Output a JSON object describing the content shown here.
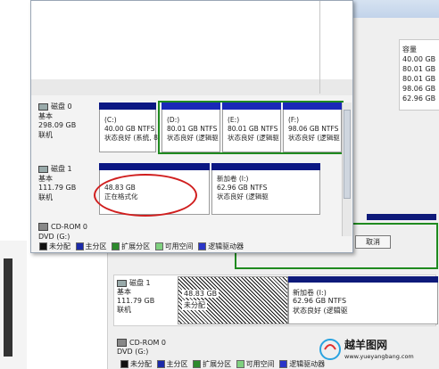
{
  "front": {
    "disk0": {
      "name": "磁盘 0",
      "type": "基本",
      "size": "298.09 GB",
      "status": "联机",
      "partitions": [
        {
          "label": "(C:)",
          "size": "40.00 GB NTFS",
          "state": "状态良好 (系统, 8"
        },
        {
          "label": "(D:)",
          "size": "80.01 GB NTFS",
          "state": "状态良好 (逻辑驱"
        },
        {
          "label": "(E:)",
          "size": "80.01 GB NTFS",
          "state": "状态良好 (逻辑驱"
        },
        {
          "label": "(F:)",
          "size": "98.06 GB NTFS",
          "state": "状态良好 (逻辑驱"
        }
      ]
    },
    "disk1": {
      "name": "磁盘 1",
      "type": "基本",
      "size": "111.79 GB",
      "status": "联机",
      "partitions": [
        {
          "size": "48.83 GB",
          "state": "正在格式化"
        },
        {
          "label": "新加卷 (I:)",
          "size": "62.96 GB NTFS",
          "state": "状态良好 (逻辑驱"
        }
      ]
    },
    "cdrom": {
      "name": "CD-ROM 0",
      "drive": "DVD (G:)"
    },
    "cancel_label": "取消"
  },
  "legend": [
    {
      "label": "未分配",
      "color": "#111111"
    },
    {
      "label": "主分区",
      "color": "#1b2aa8"
    },
    {
      "label": "扩展分区",
      "color": "#2d8a2d"
    },
    {
      "label": "可用空间",
      "color": "#7fd07f"
    },
    {
      "label": "逻辑驱动器",
      "color": "#2a35c8"
    }
  ],
  "background": {
    "capacity_header": "容量",
    "capacities": [
      "40.00 GB",
      "80.01 GB",
      "80.01 GB",
      "98.06 GB",
      "62.96 GB"
    ],
    "disk1": {
      "name": "磁盘 1",
      "type": "基本",
      "size": "111.79 GB",
      "status": "联机",
      "partitions": [
        {
          "size": "48.83 GB",
          "state": "未分配"
        },
        {
          "label": "新加卷 (I:)",
          "size": "62.96 GB NTFS",
          "state": "状态良好 (逻辑驱"
        }
      ]
    },
    "cdrom": {
      "name": "CD-ROM 0",
      "drive": "DVD (G:)"
    }
  },
  "watermark": {
    "title": "越羊图网",
    "url": "www.yueyangbang.com"
  }
}
